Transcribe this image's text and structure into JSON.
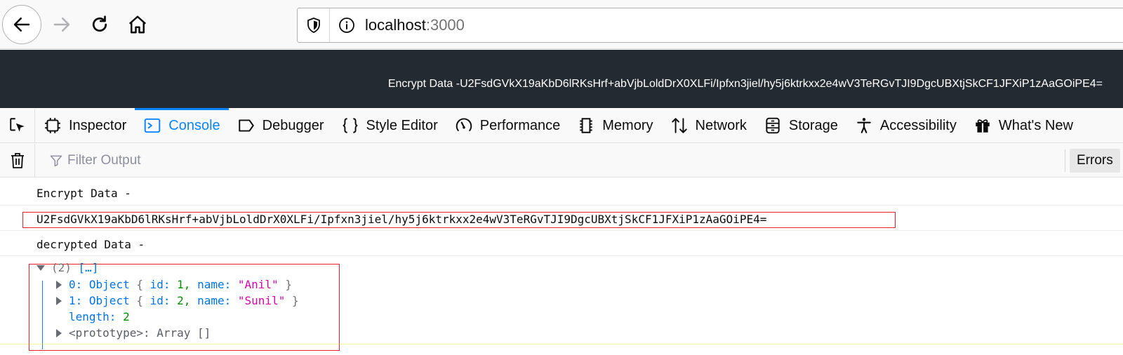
{
  "browser": {
    "url_host": "localhost",
    "url_port": ":3000"
  },
  "page": {
    "header_text": "Encrypt Data -U2FsdGVkX19aKbD6lRKsHrf+abVjbLoldDrX0XLFi/Ipfxn3jiel/hy5j6ktrkxx2e4wV3TeRGvTJI9DgcUBXtjSkCF1JFXiP1zAaGOiPE4="
  },
  "devtools": {
    "tabs": [
      {
        "label": "Inspector",
        "icon": "inspector-icon"
      },
      {
        "label": "Console",
        "icon": "console-icon",
        "selected": true
      },
      {
        "label": "Debugger",
        "icon": "debugger-icon"
      },
      {
        "label": "Style Editor",
        "icon": "braces-icon"
      },
      {
        "label": "Performance",
        "icon": "gauge-icon"
      },
      {
        "label": "Memory",
        "icon": "chip-icon"
      },
      {
        "label": "Network",
        "icon": "arrows-updown-icon"
      },
      {
        "label": "Storage",
        "icon": "storage-icon"
      },
      {
        "label": "Accessibility",
        "icon": "accessibility-icon"
      },
      {
        "label": "What's New",
        "icon": "gift-icon"
      }
    ],
    "accent_color": "#0a84ff"
  },
  "console": {
    "filter_placeholder": "Filter Output",
    "errors_label": "Errors",
    "messages": {
      "encrypt_label": "Encrypt Data -",
      "encrypt_value": "U2FsdGVkX19aKbD6lRKsHrf+abVjbLoldDrX0XLFi/Ipfxn3jiel/hy5j6ktrkxx2e4wV3TeRGvTJI9DgcUBXtjSkCF1JFXiP1zAaGOiPE4=",
      "decrypt_label": "decrypted Data -"
    },
    "array": {
      "count": "(2)",
      "preview": "[…]",
      "items": [
        {
          "index": "0:",
          "type": "Object",
          "open": "{",
          "id_key": "id:",
          "id_val": "1,",
          "name_key": "name:",
          "name_val": "\"Anil\"",
          "close": "}"
        },
        {
          "index": "1:",
          "type": "Object",
          "open": "{",
          "id_key": "id:",
          "id_val": "2,",
          "name_key": "name:",
          "name_val": "\"Sunil\"",
          "close": "}"
        }
      ],
      "length_key": "length:",
      "length_val": "2",
      "proto_key": "<prototype>:",
      "proto_val": "Array []"
    },
    "highlight_color": "#e8202a"
  }
}
